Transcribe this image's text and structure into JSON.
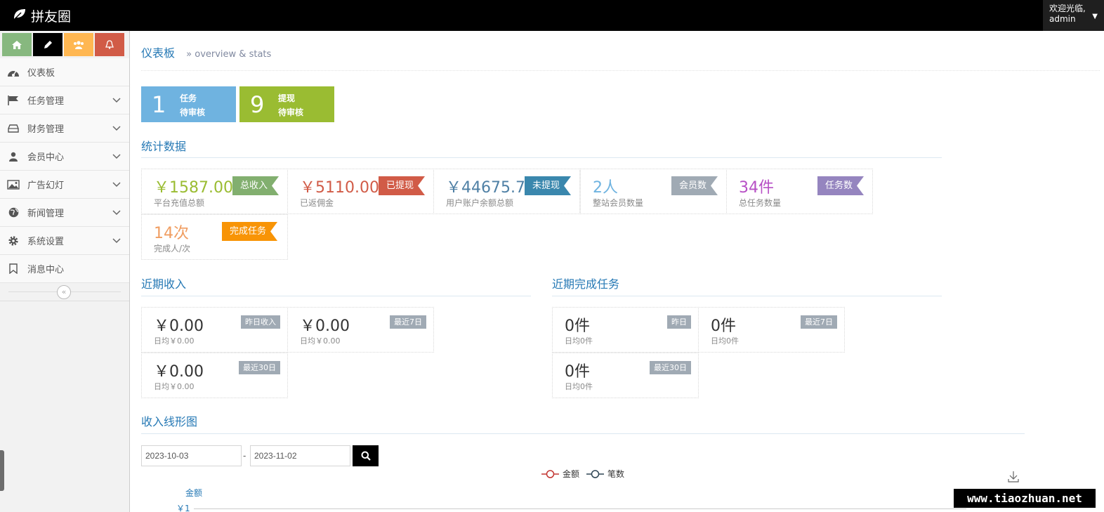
{
  "app": {
    "brand": "拼友圈"
  },
  "user": {
    "greeting": "欢迎光临,",
    "name": "admin"
  },
  "colors": {
    "green": "#87b87f",
    "orange": "#ffb752",
    "red": "#d15b47",
    "blue": "#6fb3e0",
    "olive": "#9abc32",
    "link": "#2679b5"
  },
  "shortcuts": [
    {
      "icon": "home-icon",
      "color": "#87b87f"
    },
    {
      "icon": "pencil-icon",
      "color": "#000000"
    },
    {
      "icon": "users-icon",
      "color": "#ffb752"
    },
    {
      "icon": "bell-icon",
      "color": "#d15b47"
    }
  ],
  "menu": [
    {
      "label": "仪表板",
      "icon": "dashboard-icon"
    },
    {
      "label": "任务管理",
      "icon": "flag-icon"
    },
    {
      "label": "财务管理",
      "icon": "hdd-icon"
    },
    {
      "label": "会员中心",
      "icon": "user-icon"
    },
    {
      "label": "广告幻灯",
      "icon": "picture-icon"
    },
    {
      "label": "新闻管理",
      "icon": "globe-icon"
    },
    {
      "label": "系统设置",
      "icon": "cog-icon"
    },
    {
      "label": "消息中心",
      "icon": "bookmark-icon"
    }
  ],
  "page": {
    "title": "仪表板",
    "subtitle": "» overview & stats"
  },
  "infoboxes": [
    {
      "number": "1",
      "line1": "任务",
      "line2": "待审核",
      "color": "#6fb3e0"
    },
    {
      "number": "9",
      "line1": "提现",
      "line2": "待审核",
      "color": "#9abc32"
    }
  ],
  "stats_title": "统计数据",
  "stats": [
    {
      "value": "￥1587.00",
      "desc": "平台充值总额",
      "tag": "总收入",
      "value_color": "#9abc32",
      "tag_color": "#82af6f"
    },
    {
      "value": "￥5110.00",
      "desc": "已返佣金",
      "tag": "已提现",
      "value_color": "#d15b47",
      "tag_color": "#d15b47"
    },
    {
      "value": "￥44675.71",
      "desc": "用户账户余额总额",
      "tag": "未提现",
      "value_color": "#4f80a5",
      "tag_color": "#3a87ad"
    },
    {
      "value": "2人",
      "desc": "整站会员数量",
      "tag": "会员数",
      "value_color": "#6fb3e0",
      "tag_color": "#a0aab4"
    },
    {
      "value": "34件",
      "desc": "总任务数量",
      "tag": "任务数",
      "value_color": "#b74fc5",
      "tag_color": "#9585bf"
    },
    {
      "value": "14次",
      "desc": "完成人/次",
      "tag": "完成任务",
      "value_color": "#f09d61",
      "tag_color": "#f89406"
    }
  ],
  "income": {
    "title": "近期收入",
    "items": [
      {
        "value": "￥0.00",
        "desc": "日均￥0.00",
        "badge": "昨日收入"
      },
      {
        "value": "￥0.00",
        "desc": "日均￥0.00",
        "badge": "最近7日"
      },
      {
        "value": "￥0.00",
        "desc": "日均￥0.00",
        "badge": "最近30日"
      }
    ]
  },
  "tasks": {
    "title": "近期完成任务",
    "items": [
      {
        "value": "0件",
        "desc": "日均0件",
        "badge": "昨日"
      },
      {
        "value": "0件",
        "desc": "日均0件",
        "badge": "最近7日"
      },
      {
        "value": "0件",
        "desc": "日均0件",
        "badge": "最近30日"
      }
    ]
  },
  "chart_section": {
    "title": "收入线形图",
    "date_from": "2023-10-03",
    "date_sep": "-",
    "date_to": "2023-11-02",
    "legend": [
      {
        "name": "金额",
        "color": "#c23531"
      },
      {
        "name": "笔数",
        "color": "#2f4554"
      }
    ],
    "yaxis_name": "金额",
    "ytick_partial": "￥1"
  },
  "watermark": "www.tiaozhuan.net"
}
